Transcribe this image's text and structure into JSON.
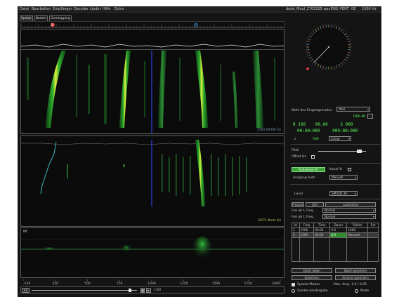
{
  "menu": {
    "items": [
      "Datei",
      "Bearbeiten",
      "Empfänger",
      "Decoder",
      "Lieder",
      "Hilfe",
      "Extra"
    ],
    "right": [
      "datei_Moul_2702025.wav",
      "ENG",
      "PENT",
      "08",
      "1500 Hz"
    ]
  },
  "tabs": [
    "Spektr",
    "Nadeln",
    "Overlapping"
  ],
  "ruler": {
    "marker_red": "B",
    "marker_blue": "A",
    "bottom_ticks": [
      "-120",
      "250",
      "500",
      "750",
      "1000",
      "1250",
      "1500",
      "1750",
      "2000"
    ]
  },
  "panels": {
    "waterfall_caption": "1500.00000 Hz",
    "spectrum_caption": "DATS Mode 64",
    "lower_caption": "Mf"
  },
  "playback": {
    "left_button": "Ab",
    "right_buttons": [
      "Stop",
      "Play"
    ],
    "speed_label": "1:60",
    "slider_value": 0.93
  },
  "right": {
    "wahl_label": "Wahl des Eingangsmodus",
    "wahl_value": "Mod",
    "db_label": "DDS dB",
    "green_row1": [
      "R",
      "100",
      "00.00",
      "S",
      "000"
    ],
    "green_row2": [
      "00:00:000",
      "000:00:000"
    ],
    "rate_label": "z",
    "rate_value": "500",
    "rate_select": "Linear",
    "pitch_label": "Pitch",
    "offset_label": "Offset Hz",
    "pitch_slider": 0.85,
    "btn_aufnahme": "Aufnahme AT",
    "kanal_label": "Kanal %",
    "auto_label": "Ausgang Auto",
    "auto_select": "Manuell",
    "level_label": "Level",
    "level_select": "SMODE 30",
    "three_buttons": [
      "Frequenz",
      "Zeit",
      "Lautstärke"
    ],
    "row_a_label": "Frei ab t, Freq.",
    "row_a_select": "Normal",
    "row_b_label": "Frei ab t, Freq.",
    "row_b_select": "Normal",
    "table_headers": [
      "Id",
      "Freq",
      "Time",
      "Dauer",
      "Stärke",
      "Ext"
    ],
    "table_rows": [
      [
        "1",
        "1500",
        "00.00",
        "0.0",
        "1000",
        ""
      ],
      [
        "2",
        "1505",
        "00.00",
        "0.0",
        "Manuell",
        ""
      ]
    ],
    "bottom_buttons_1": [
      "Datei laden",
      "Datei speichern"
    ],
    "bottom_buttons_2": [
      "Speichern",
      "Ansicht speichern"
    ],
    "bottom_checks": [
      "Spezial-Modus",
      "Sender-wiedergabe"
    ],
    "bottom_radios": [
      "Vollbild",
      "Mode"
    ],
    "bottom_right_text": "Max. Amp. 1.0 / 0.95"
  },
  "colors": {
    "accent_green": "#5cff5c",
    "trace_cyan": "#3ecbd8",
    "cursor_blue": "#2a3fd8",
    "marker_red": "#d83a3a",
    "marker_blue": "#3ba9ff"
  },
  "icons": [
    "compass-dial-icon",
    "stop-icon",
    "play-icon",
    "record-icon"
  ]
}
